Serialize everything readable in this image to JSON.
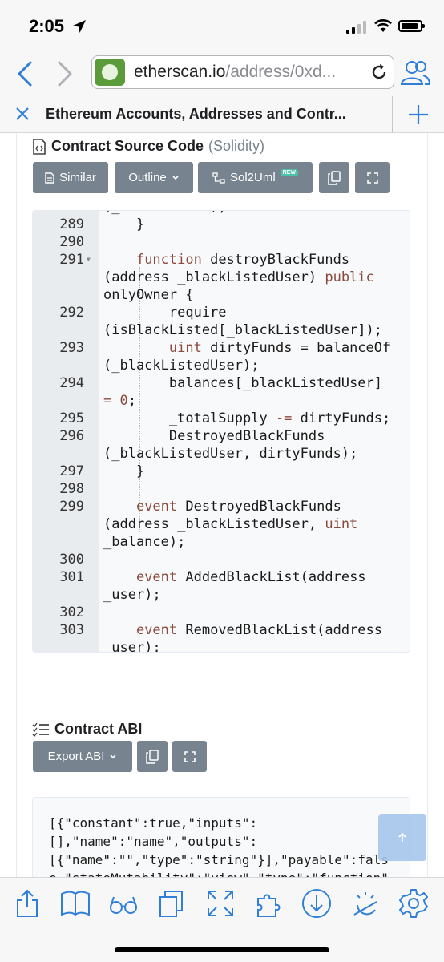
{
  "status": {
    "time": "2:05"
  },
  "browser": {
    "url_domain": "etherscan.io",
    "url_path": "/address/0xd...",
    "tab_title": "Ethereum Accounts, Addresses and Contr..."
  },
  "source": {
    "title": "Contract Source Code",
    "lang": "(Solidity)",
    "buttons": {
      "similar": "Similar",
      "outline": "Outline",
      "sol2uml": "Sol2Uml",
      "new_badge": "NEW"
    }
  },
  "code_lines": [
    {
      "ln": "",
      "text": "(_clearedUser);"
    },
    {
      "ln": "289",
      "text": "    }"
    },
    {
      "ln": "290",
      "text": ""
    },
    {
      "ln": "291",
      "text": "    function destroyBlackFunds"
    },
    {
      "ln": "",
      "text": "(address _blackListedUser) public"
    },
    {
      "ln": "",
      "text": "onlyOwner {"
    },
    {
      "ln": "292",
      "text": "        require"
    },
    {
      "ln": "",
      "text": "(isBlackListed[_blackListedUser]);"
    },
    {
      "ln": "293",
      "text": "        uint dirtyFunds = balanceOf"
    },
    {
      "ln": "",
      "text": "(_blackListedUser);"
    },
    {
      "ln": "294",
      "text": "        balances[_blackListedUser]"
    },
    {
      "ln": "",
      "text": "= 0;"
    },
    {
      "ln": "295",
      "text": "        _totalSupply -= dirtyFunds;"
    },
    {
      "ln": "296",
      "text": "        DestroyedBlackFunds"
    },
    {
      "ln": "",
      "text": "(_blackListedUser, dirtyFunds);"
    },
    {
      "ln": "297",
      "text": "    }"
    },
    {
      "ln": "298",
      "text": ""
    },
    {
      "ln": "299",
      "text": "    event DestroyedBlackFunds"
    },
    {
      "ln": "",
      "text": "(address _blackListedUser, uint"
    },
    {
      "ln": "",
      "text": "_balance);"
    },
    {
      "ln": "300",
      "text": ""
    },
    {
      "ln": "301",
      "text": "    event AddedBlackList(address"
    },
    {
      "ln": "",
      "text": "_user);"
    },
    {
      "ln": "302",
      "text": ""
    },
    {
      "ln": "303",
      "text": "    event RemovedBlackList(address"
    },
    {
      "ln": "",
      "text": "_user);"
    }
  ],
  "abi": {
    "title": "Contract ABI",
    "export_label": "Export ABI",
    "lines": [
      "[{\"constant\":true,\"inputs\":",
      "[],\"name\":\"name\",\"outputs\":",
      "[{\"name\":\"\",\"type\":\"string\"}],\"payable\":fals",
      "e,\"stateMutability\":\"view\",\"type\":\"function\""
    ]
  },
  "colors": {
    "button_gray": "#77838f",
    "accent_blue": "#2f7fd8",
    "badge_green": "#4cc2a9"
  }
}
